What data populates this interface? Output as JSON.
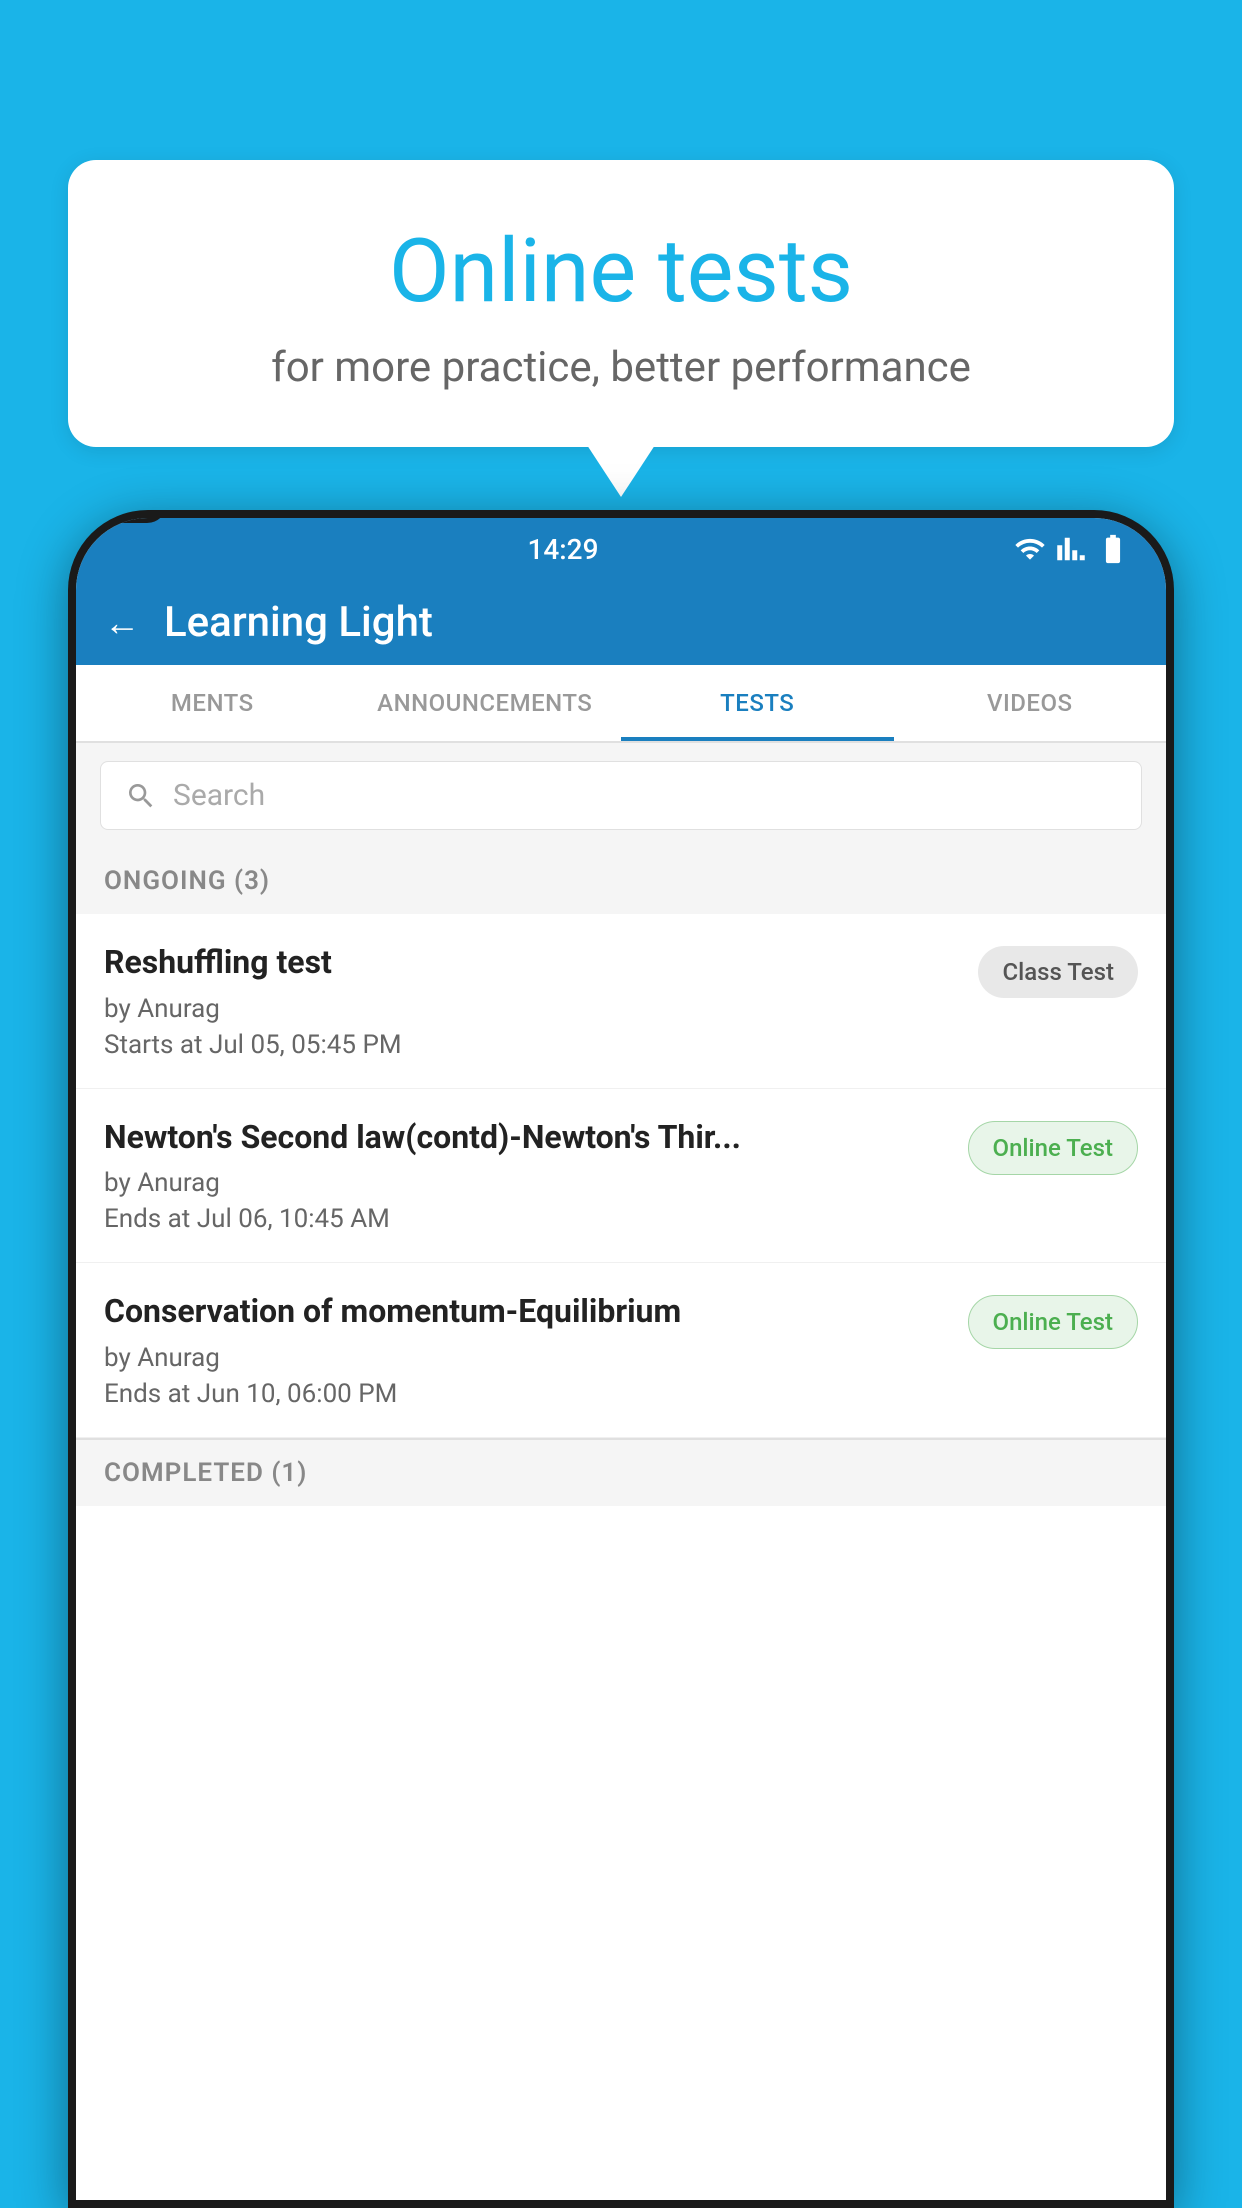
{
  "background_color": "#1ab4e8",
  "bubble": {
    "title": "Online tests",
    "subtitle": "for more practice, better performance"
  },
  "status_bar": {
    "time": "14:29",
    "icons": [
      "wifi",
      "signal",
      "battery"
    ]
  },
  "header": {
    "back_label": "←",
    "title": "Learning Light"
  },
  "tabs": [
    {
      "label": "MENTS",
      "active": false
    },
    {
      "label": "ANNOUNCEMENTS",
      "active": false
    },
    {
      "label": "TESTS",
      "active": true
    },
    {
      "label": "VIDEOS",
      "active": false
    }
  ],
  "search": {
    "placeholder": "Search"
  },
  "sections": [
    {
      "name": "ONGOING (3)",
      "items": [
        {
          "name": "Reshuffling test",
          "author": "by Anurag",
          "time": "Starts at  Jul 05, 05:45 PM",
          "badge": "Class Test",
          "badge_type": "class"
        },
        {
          "name": "Newton's Second law(contd)-Newton's Thir...",
          "author": "by Anurag",
          "time": "Ends at  Jul 06, 10:45 AM",
          "badge": "Online Test",
          "badge_type": "online"
        },
        {
          "name": "Conservation of momentum-Equilibrium",
          "author": "by Anurag",
          "time": "Ends at  Jun 10, 06:00 PM",
          "badge": "Online Test",
          "badge_type": "online"
        }
      ]
    }
  ],
  "completed_section": {
    "name": "COMPLETED (1)"
  }
}
